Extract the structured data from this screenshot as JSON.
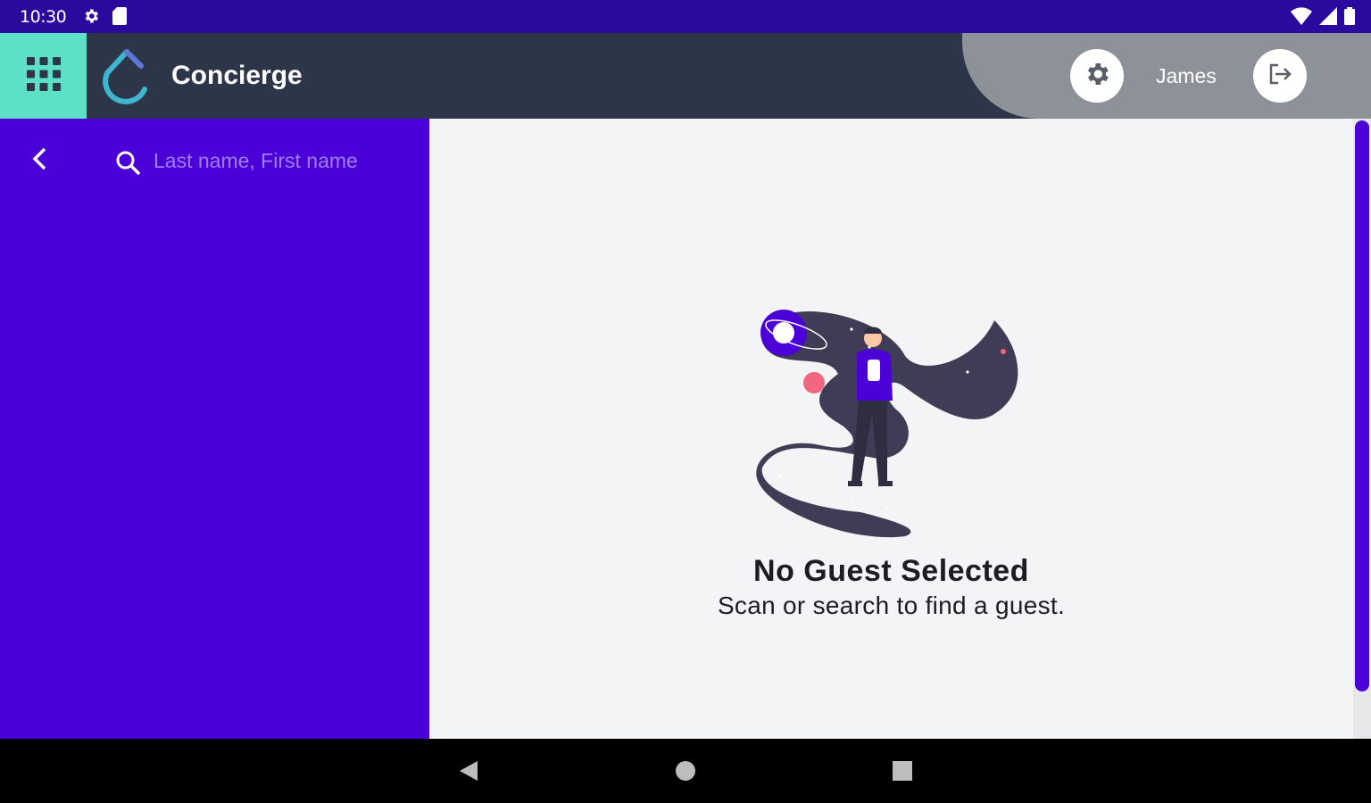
{
  "status_bar": {
    "time": "10:30",
    "icons_left": [
      "gear-icon",
      "sd-card-icon"
    ],
    "icons_right": [
      "wifi-icon",
      "signal-icon",
      "battery-icon"
    ]
  },
  "header": {
    "app_title": "Concierge",
    "user_name": "James",
    "icons": [
      "apps-grid-icon",
      "concierge-logo-icon",
      "settings-icon",
      "logout-icon"
    ]
  },
  "sidebar": {
    "search": {
      "placeholder": "Last name, First name",
      "value": ""
    },
    "icons": [
      "back-chevron-icon",
      "search-icon"
    ]
  },
  "main": {
    "empty_state": {
      "title": "No Guest Selected",
      "subtitle": "Scan or search to find a guest."
    }
  },
  "nav_bar": {
    "buttons": [
      "back-triangle-icon",
      "home-circle-icon",
      "recents-square-icon"
    ]
  },
  "colors": {
    "status_bar": "#2a0a9c",
    "header": "#2d3648",
    "accent_teal": "#5ee0c6",
    "sidebar": "#4a00d6",
    "user_panel": "#8d9198",
    "content_bg": "#f3f4f6"
  }
}
